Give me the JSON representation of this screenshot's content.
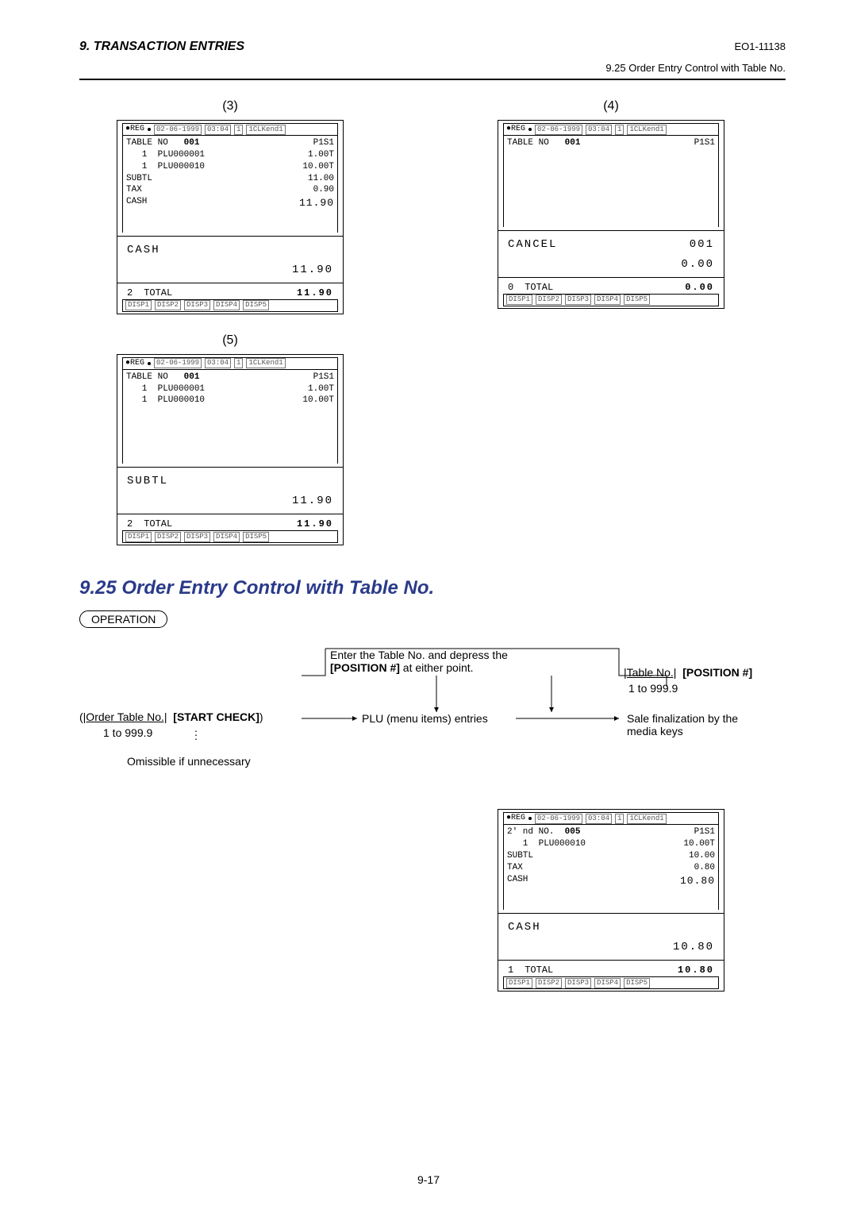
{
  "header": {
    "left": "9.   TRANSACTION ENTRIES",
    "right": "EO1-11138",
    "sub": "9.25  Order Entry Control with Table No."
  },
  "labels": {
    "c3": "(3)",
    "c4": "(4)",
    "c5": "(5)"
  },
  "bar": {
    "reg": "●REG",
    "date": "02-06-1999",
    "time": "03:04",
    "seq": "1",
    "clk": "1CLKend1",
    "p1s1": "P1S1",
    "disp1": "DISP1",
    "disp2": "DISP2",
    "disp3": "DISP3",
    "disp4": "DISP4",
    "disp5": "DISP5"
  },
  "r3": {
    "l1a": "TABLE NO   ",
    "l1b": "001",
    "l2a": "   1  PLU000001",
    "l2b": "1.00T",
    "l3a": "   1  PLU000010",
    "l3b": "10.00T",
    "l4a": "SUBTL",
    "l4b": "11.00",
    "l5a": "TAX",
    "l5b": "0.90",
    "l6a": "CASH",
    "l6b": "11.90",
    "big1": "CASH",
    "big2": "11.90",
    "tcount": "2",
    "tlabel": "TOTAL",
    "tval": "11.90"
  },
  "r4": {
    "l1a": "TABLE NO   ",
    "l1b": "001",
    "big1": "CANCEL",
    "big1r": "001",
    "big2": "0.00",
    "tcount": "0",
    "tlabel": "TOTAL",
    "tval": "0.00"
  },
  "r5": {
    "l1a": "TABLE NO   ",
    "l1b": "001",
    "l2a": "   1  PLU000001",
    "l2b": "1.00T",
    "l3a": "   1  PLU000010",
    "l3b": "10.00T",
    "big1": "SUBTL",
    "big2": "11.90",
    "tcount": "2",
    "tlabel": "TOTAL",
    "tval": "11.90"
  },
  "section_title": "9.25    Order Entry Control with Table No.",
  "op_badge": "OPERATION",
  "flow": {
    "enter1": "Enter the Table No. and depress the",
    "enter2a": "[POSITION #]",
    "enter2b": " at either point.",
    "left_u": "|Order Table No.|",
    "left_k": "[START CHECK]",
    "left_range": "1 to 999.9",
    "omit": "Omissible if unnecessary",
    "mid": "PLU (menu items) entries",
    "right_u": "|Table No.|",
    "right_k": "[POSITION #]",
    "right_range": "1 to 999.9",
    "fin": "Sale finalization by the",
    "fin2": "media keys"
  },
  "r6": {
    "l1a": "2' nd NO.  ",
    "l1b": "005",
    "l2a": "   1  PLU000010",
    "l2b": "10.00T",
    "l3a": "SUBTL",
    "l3b": "10.00",
    "l4a": "TAX",
    "l4b": "0.80",
    "l5a": "CASH",
    "l5b": "10.80",
    "big1": "CASH",
    "big2": "10.80",
    "tcount": "1",
    "tlabel": "TOTAL",
    "tval": "10.80"
  },
  "page_no": "9-17"
}
